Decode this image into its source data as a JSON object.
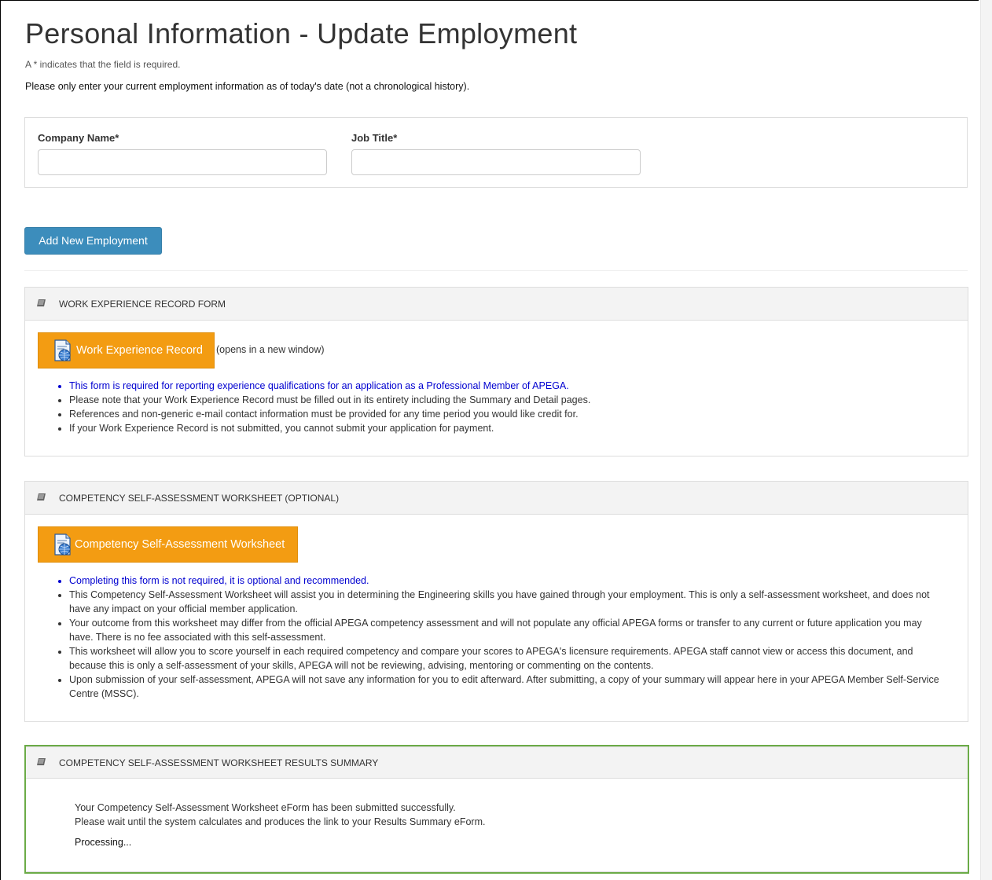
{
  "page": {
    "title": "Personal Information - Update Employment",
    "required_note": "A * indicates that the field is required.",
    "instruction": "Please only enter your current employment information as of today's date (not a chronological history)."
  },
  "employment_form": {
    "company_label": "Company Name*",
    "company_value": "",
    "job_title_label": "Job Title*",
    "job_title_value": "",
    "add_button": "Add New Employment"
  },
  "work_experience_panel": {
    "heading": "WORK EXPERIENCE RECORD FORM",
    "button_label": "Work Experience Record",
    "button_note": "(opens in a new window)",
    "bullets": [
      "This form is required for reporting experience qualifications for an application as a Professional Member of APEGA.",
      "Please note that your Work Experience Record must be filled out in its entirety including the Summary and Detail pages.",
      "References and non-generic e-mail contact information must be provided for any time period you would like credit for.",
      "If your Work Experience Record is not submitted, you cannot submit your application for payment."
    ]
  },
  "competency_panel": {
    "heading": "COMPETENCY SELF-ASSESSMENT WORKSHEET (OPTIONAL)",
    "button_label": "Competency Self-Assessment Worksheet",
    "bullets": [
      "Completing this form is not required, it is optional and recommended.",
      "This Competency Self-Assessment Worksheet will assist you in determining the Engineering skills you have gained through your employment.  This is only a self-assessment worksheet, and does not have any impact on your official member application.",
      "Your outcome from this worksheet may differ from the official APEGA competency assessment and will not populate any official APEGA forms or transfer to any current or future application you may have.  There is no fee associated with this self-assessment.",
      "This worksheet will allow you to score yourself in each required competency and compare your scores to APEGA's licensure requirements. APEGA staff cannot view or access this document, and because this is only a self-assessment of your skills, APEGA will not be reviewing, advising, mentoring or commenting on the contents.",
      "Upon submission of your self-assessment, APEGA will not save any information for you to edit afterward.  After submitting, a copy of your summary will appear here in your APEGA Member Self-Service Centre (MSSC)."
    ]
  },
  "results_panel": {
    "heading": "COMPETENCY SELF-ASSESSMENT WORKSHEET RESULTS SUMMARY",
    "line1": "Your Competency Self-Assessment Worksheet eForm has been submitted successfully.",
    "line2": "Please wait until the system calculates and produces the link to your Results Summary eForm.",
    "status": "Processing..."
  },
  "colors": {
    "primary_button": "#3c8dbc",
    "orange_button": "#f39c12",
    "highlight_border": "#6bab47",
    "link_blue": "#0000d0"
  },
  "icons": {
    "panel_heading": "book-icon",
    "document_button": "document-globe-icon"
  }
}
